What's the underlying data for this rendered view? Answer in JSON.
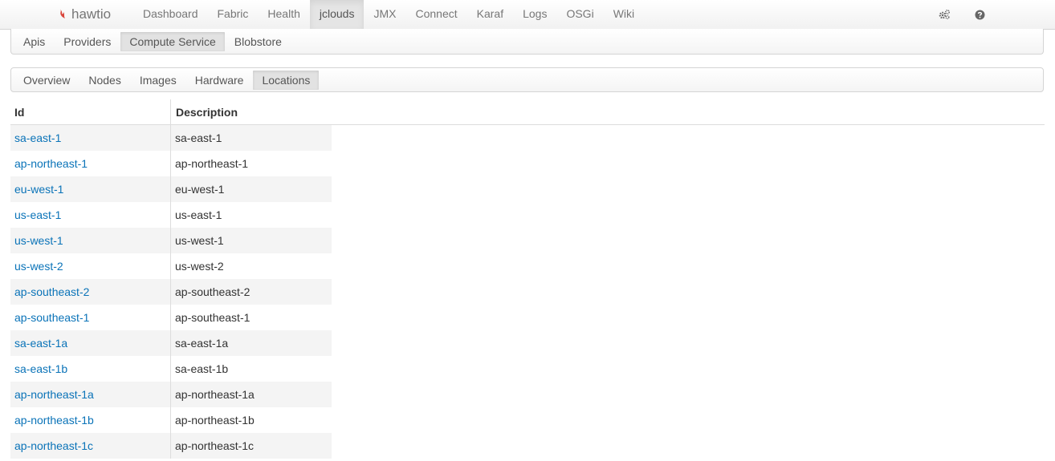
{
  "brand": {
    "name": "hawtio",
    "icon": "flame-icon",
    "accent": "#d9453b"
  },
  "nav": {
    "items": [
      "Dashboard",
      "Fabric",
      "Health",
      "jclouds",
      "JMX",
      "Connect",
      "Karaf",
      "Logs",
      "OSGi",
      "Wiki"
    ],
    "active": "jclouds",
    "right_icons": [
      "cogs-icon",
      "help-icon"
    ]
  },
  "subnav1": {
    "items": [
      "Apis",
      "Providers",
      "Compute Service",
      "Blobstore"
    ],
    "active": "Compute Service"
  },
  "subnav2": {
    "items": [
      "Overview",
      "Nodes",
      "Images",
      "Hardware",
      "Locations"
    ],
    "active": "Locations"
  },
  "table": {
    "headers": [
      "Id",
      "Description"
    ],
    "link_color": "#0a73b8",
    "rows": [
      [
        "sa-east-1",
        "sa-east-1"
      ],
      [
        "ap-northeast-1",
        "ap-northeast-1"
      ],
      [
        "eu-west-1",
        "eu-west-1"
      ],
      [
        "us-east-1",
        "us-east-1"
      ],
      [
        "us-west-1",
        "us-west-1"
      ],
      [
        "us-west-2",
        "us-west-2"
      ],
      [
        "ap-southeast-2",
        "ap-southeast-2"
      ],
      [
        "ap-southeast-1",
        "ap-southeast-1"
      ],
      [
        "sa-east-1a",
        "sa-east-1a"
      ],
      [
        "sa-east-1b",
        "sa-east-1b"
      ],
      [
        "ap-northeast-1a",
        "ap-northeast-1a"
      ],
      [
        "ap-northeast-1b",
        "ap-northeast-1b"
      ],
      [
        "ap-northeast-1c",
        "ap-northeast-1c"
      ]
    ]
  }
}
